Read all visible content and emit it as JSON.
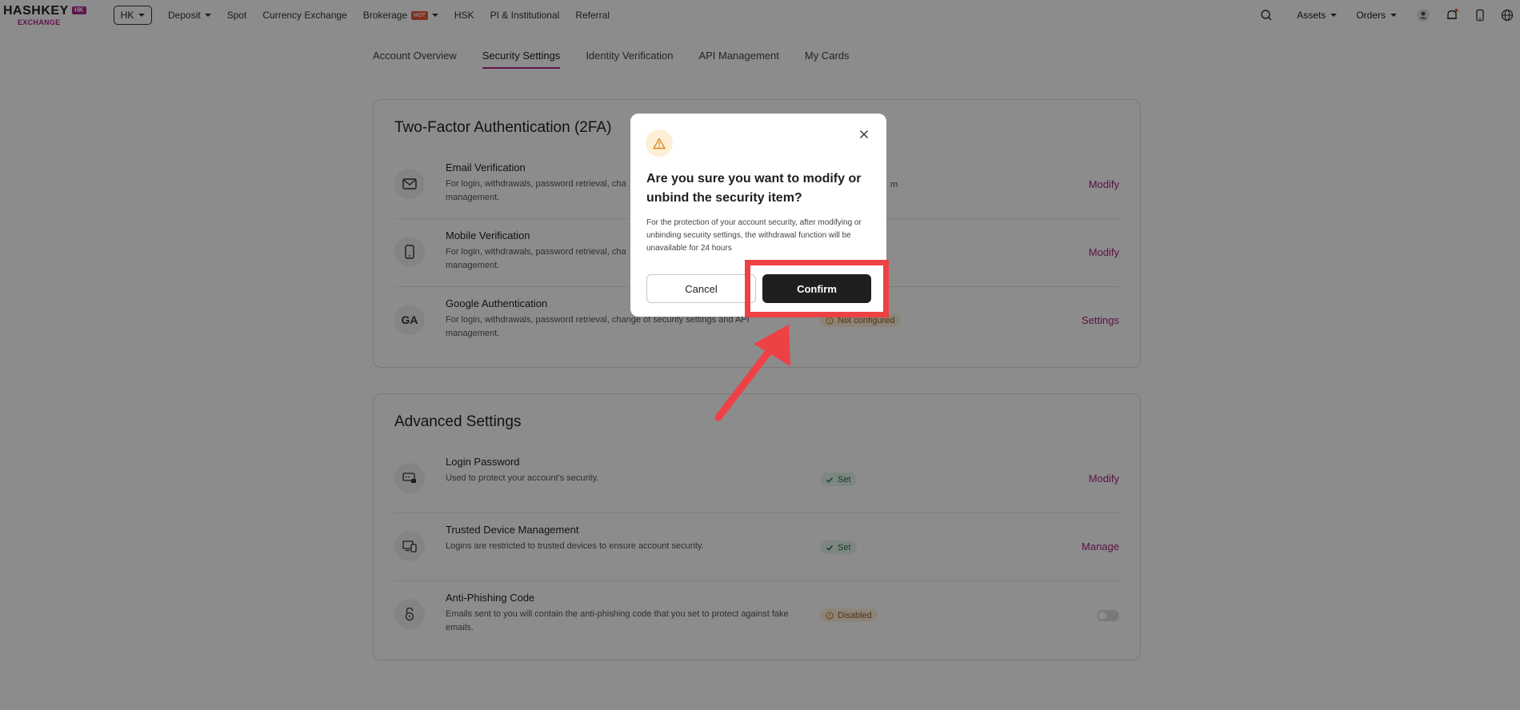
{
  "nav": {
    "logo_main": "HASHKEY",
    "logo_badge": "HK",
    "logo_sub": "EXCHANGE",
    "region": "HK",
    "links": [
      {
        "label": "Deposit",
        "dropdown": true
      },
      {
        "label": "Spot"
      },
      {
        "label": "Currency Exchange"
      },
      {
        "label": "Brokerage",
        "badge": "HOT",
        "dropdown": true
      },
      {
        "label": "HSK"
      },
      {
        "label": "PI & Institutional"
      },
      {
        "label": "Referral"
      }
    ],
    "assets": "Assets",
    "orders": "Orders",
    "icons": [
      "search-icon",
      "user-icon",
      "bell-icon",
      "phone-icon",
      "globe-icon"
    ]
  },
  "tabs": [
    "Account Overview",
    "Security Settings",
    "Identity Verification",
    "API Management",
    "My Cards"
  ],
  "active_tab": "Security Settings",
  "twofa": {
    "title": "Two-Factor Authentication (2FA)",
    "rows": [
      {
        "title": "Email Verification",
        "desc": "For login, withdrawals, password retrieval, cha",
        "desc2": "management.",
        "status_tail": "m",
        "action": "Modify"
      },
      {
        "title": "Mobile Verification",
        "desc": "For login, withdrawals, password retrieval, cha",
        "desc2": "management.",
        "action": "Modify"
      },
      {
        "title": "Google Authentication",
        "icon_text": "GA",
        "desc": "For login, withdrawals, password retrieval, change of security settings and API",
        "desc2": "management.",
        "status": "Not configured",
        "action": "Settings"
      }
    ]
  },
  "advanced": {
    "title": "Advanced Settings",
    "rows": [
      {
        "title": "Login Password",
        "desc": "Used to protect your account's security.",
        "status": "Set",
        "action": "Modify"
      },
      {
        "title": "Trusted Device Management",
        "desc": "Logins are restricted to trusted devices to ensure account security.",
        "status": "Set",
        "action": "Manage"
      },
      {
        "title": "Anti-Phishing Code",
        "desc": "Emails sent to you will contain the anti-phishing code that you set to protect against fake",
        "desc2": "emails.",
        "status": "Disabled",
        "toggle": false
      }
    ]
  },
  "modal": {
    "title": "Are you sure you want to modify or unbind the security item?",
    "body": "For the protection of your account security, after modifying or unbinding security settings, the withdrawal function will be unavailable for 24 hours",
    "cancel": "Cancel",
    "confirm": "Confirm"
  },
  "colors": {
    "accent": "#b0238d",
    "annotation": "#ee4146",
    "set_green": "#22764a",
    "warn_orange": "#9a5a14"
  }
}
